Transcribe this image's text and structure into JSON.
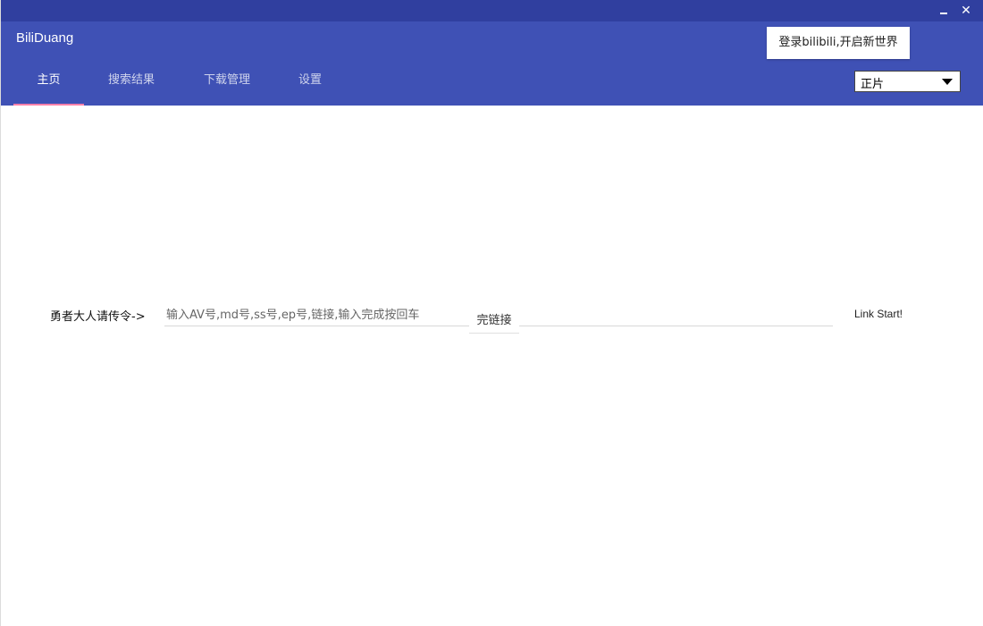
{
  "window": {
    "minimize_glyph": "",
    "close_glyph": "✕"
  },
  "header": {
    "app_title": "BiliDuang",
    "login_button": "登录bilibili,开启新世界"
  },
  "tabs": [
    {
      "label": "主页",
      "active": true
    },
    {
      "label": "搜索结果",
      "active": false
    },
    {
      "label": "下载管理",
      "active": false
    },
    {
      "label": "设置",
      "active": false
    }
  ],
  "type_select": {
    "selected": "正片"
  },
  "command": {
    "label": "勇者大人请传令->",
    "placeholder": "输入AV号,md号,ss号,ep号,链接,输入完成按回车",
    "suggestion": "完链接",
    "submit_label": "Link Start!"
  },
  "colors": {
    "titlebar": "#303f9f",
    "header": "#3f51b5",
    "tab_indicator": "#ff80ab"
  }
}
